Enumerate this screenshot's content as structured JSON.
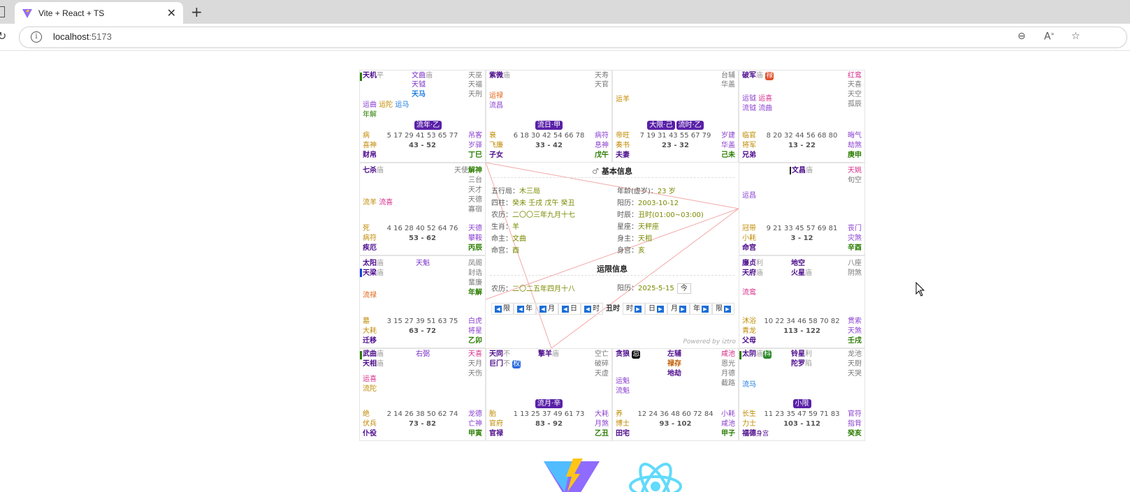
{
  "browser": {
    "tab_title": "Vite + React + TS",
    "url_host": "localhost",
    "url_port": ":5173"
  },
  "cells": {
    "si": {
      "stars": [
        "天机",
        "平",
        "文曲",
        "庙",
        "天钺",
        "天马",
        "天巫",
        "天福",
        "天刑"
      ],
      "liu": [
        "运曲",
        "运陀",
        "运马",
        "年解"
      ],
      "tag": "流年·乙",
      "changsheng": "病",
      "boshi": "喜神",
      "ages": "5 17 29 41 53 65 77",
      "range": "43 - 52",
      "palace": "财帛",
      "gz": "丁巳",
      "r1": "吊客",
      "r2": "岁驿"
    },
    "wu": {
      "stars": [
        "紫微",
        "庙",
        "天寿",
        "天官"
      ],
      "liu": [
        "运禄",
        "流昌"
      ],
      "tag": "流日·甲",
      "changsheng": "衰",
      "boshi": "飞廉",
      "ages": "6 18 30 42 54 66 78",
      "range": "33 - 42",
      "palace": "子女",
      "gz": "戊午",
      "r1": "病符",
      "r2": "息神"
    },
    "wei": {
      "stars": [
        "台辅",
        "华盖"
      ],
      "liu": [
        "运羊"
      ],
      "tag1": "大限·己",
      "tag2": "流时·乙",
      "changsheng": "帝旺",
      "boshi": "奏书",
      "ages": "7 19 31 43 55 67 79",
      "range": "23 - 32",
      "palace": "夫妻",
      "gz": "己未",
      "r1": "岁建",
      "r2": "华盖"
    },
    "shen": {
      "stars": [
        "破军",
        "庙",
        "禄",
        "红鸾",
        "天喜",
        "天空",
        "孤辰"
      ],
      "liu": [
        "运钺",
        "运喜",
        "流钺",
        "流曲"
      ],
      "changsheng": "临官",
      "boshi": "将军",
      "ages": "8 20 32 44 56 68 80",
      "range": "13 - 22",
      "palace": "兄弟",
      "gz": "庚申",
      "r1": "晦气",
      "r2": "劫煞"
    },
    "chen": {
      "stars": [
        "七杀",
        "庙",
        "天使",
        "解神",
        "三台",
        "天才",
        "天德",
        "寡宿"
      ],
      "liu": [
        "流羊",
        "流喜"
      ],
      "changsheng": "死",
      "boshi": "病符",
      "ages": "4 16 28 40 52 64 76",
      "range": "53 - 62",
      "palace": "疾厄",
      "gz": "丙辰",
      "r1": "天德",
      "r2": "攀鞍"
    },
    "you": {
      "stars": [
        "文昌",
        "庙",
        "天姚",
        "旬空"
      ],
      "liu": [
        "运昌"
      ],
      "changsheng": "冠带",
      "boshi": "小耗",
      "ages": "9 21 33 45 57 69 81",
      "range": "3 - 12",
      "palace": "命宫",
      "gz": "辛酉",
      "r1": "丧门",
      "r2": "灾煞"
    },
    "mao": {
      "stars": [
        "太阳",
        "庙",
        "天梁",
        "庙",
        "天魁",
        "凤阁",
        "封诰",
        "蜚廉",
        "年解"
      ],
      "liu": [
        "流禄"
      ],
      "changsheng": "墓",
      "boshi": "大耗",
      "ages": "3 15 27 39 51 63 75",
      "range": "63 - 72",
      "palace": "迁移",
      "gz": "乙卯",
      "r1": "白虎",
      "r2": "将星"
    },
    "xu": {
      "stars": [
        "廉贞",
        "利",
        "天府",
        "庙",
        "地空",
        "火星",
        "庙",
        "八座",
        "阴煞"
      ],
      "liu": [
        "流鸾"
      ],
      "changsheng": "沐浴",
      "boshi": "青龙",
      "ages": "10 22 34 46 58 70 82",
      "range": "113 - 122",
      "palace": "父母",
      "gz": "壬戌",
      "r1": "贯索",
      "r2": "天煞"
    },
    "yin": {
      "stars": [
        "武曲",
        "庙",
        "天相",
        "庙",
        "右弼",
        "天喜",
        "天月",
        "天伤"
      ],
      "liu": [
        "运喜",
        "流陀"
      ],
      "changsheng": "绝",
      "boshi": "伏兵",
      "ages": "2 14 26 38 50 62 74",
      "range": "73 - 82",
      "palace": "仆役",
      "gz": "甲寅",
      "r1": "龙德",
      "r2": "亡神"
    },
    "chou": {
      "stars": [
        "天同",
        "不",
        "巨门",
        "不",
        "权",
        "擎羊",
        "庙",
        "空亡",
        "破碎",
        "天虚"
      ],
      "liu": [],
      "tag": "流月·辛",
      "changsheng": "胎",
      "boshi": "官府",
      "ages": "1 13 25 37 49 61 73",
      "range": "83 - 92",
      "palace": "官禄",
      "gz": "乙丑",
      "r1": "大耗",
      "r2": "月煞"
    },
    "zi": {
      "stars": [
        "贪狼",
        "忌",
        "左辅",
        "禄存",
        "地劫",
        "咸池",
        "恩光",
        "月德",
        "截路"
      ],
      "liu": [
        "运魁",
        "流魁"
      ],
      "changsheng": "养",
      "boshi": "博士",
      "ages": "12 24 36 48 60 72 84",
      "range": "93 - 102",
      "palace": "田宅",
      "gz": "甲子",
      "r1": "小耗",
      "r2": "咸池"
    },
    "hai": {
      "stars": [
        "太阴",
        "庙",
        "科",
        "铃星",
        "利",
        "陀罗",
        "陷",
        "龙池",
        "天厨",
        "天哭"
      ],
      "liu": [
        "流马"
      ],
      "tag": "小限",
      "changsheng": "长生",
      "boshi": "力士",
      "ages": "11 23 35 47 59 71 83",
      "range": "103 - 112",
      "palace": "福德",
      "palace_extra": "身宫",
      "gz": "癸亥",
      "r1": "官符",
      "r2": "指背"
    }
  },
  "center": {
    "basic_title": "基本信息",
    "basic_icon": "gender-icon",
    "rows_left": [
      {
        "label": "五行局：",
        "value": "木三局"
      },
      {
        "label": "四柱：",
        "value": "癸未 壬戌 戊午 癸丑"
      },
      {
        "label": "农历：",
        "value": "二〇〇三年九月十七"
      },
      {
        "label": "生肖：",
        "value": "羊"
      },
      {
        "label": "命主：",
        "value": "文曲"
      },
      {
        "label": "命宫：",
        "value": "酉"
      }
    ],
    "rows_right": [
      {
        "label": "年龄(虚岁)：",
        "value": "23 岁"
      },
      {
        "label": "阳历：",
        "value": "2003-10-12"
      },
      {
        "label": "时辰：",
        "value": "丑时(01:00~03:00)"
      },
      {
        "label": "星座：",
        "value": "天秤座"
      },
      {
        "label": "身主：",
        "value": "天相"
      },
      {
        "label": "身宫：",
        "value": "亥"
      }
    ],
    "yun_title": "运限信息",
    "yun_lunar_label": "农历：",
    "yun_lunar": "二〇二五年四月十八",
    "yun_solar_label": "阳历：",
    "yun_solar": "2025-5-15",
    "today": "今",
    "controls": [
      "限",
      "年",
      "月",
      "日",
      "时",
      "丑时",
      "时",
      "日",
      "月",
      "年",
      "限"
    ],
    "powered": "Powered by iztro"
  }
}
